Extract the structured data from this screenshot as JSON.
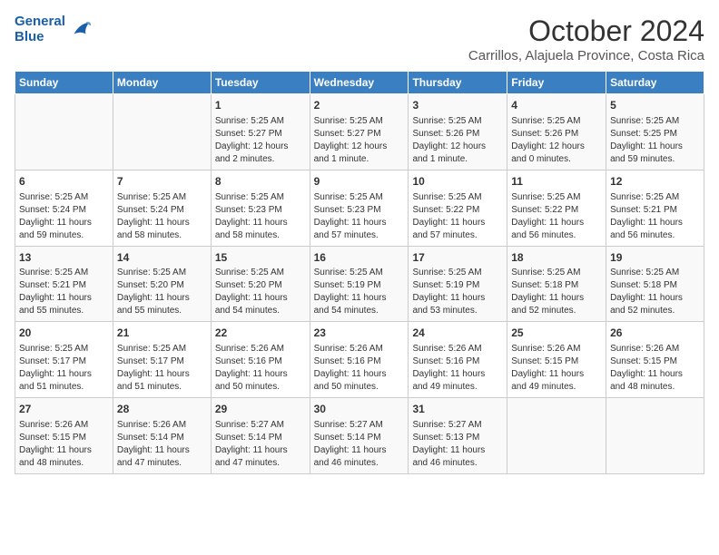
{
  "logo": {
    "line1": "General",
    "line2": "Blue"
  },
  "title": "October 2024",
  "subtitle": "Carrillos, Alajuela Province, Costa Rica",
  "days_of_week": [
    "Sunday",
    "Monday",
    "Tuesday",
    "Wednesday",
    "Thursday",
    "Friday",
    "Saturday"
  ],
  "weeks": [
    [
      {
        "day": "",
        "content": ""
      },
      {
        "day": "",
        "content": ""
      },
      {
        "day": "1",
        "content": "Sunrise: 5:25 AM\nSunset: 5:27 PM\nDaylight: 12 hours\nand 2 minutes."
      },
      {
        "day": "2",
        "content": "Sunrise: 5:25 AM\nSunset: 5:27 PM\nDaylight: 12 hours\nand 1 minute."
      },
      {
        "day": "3",
        "content": "Sunrise: 5:25 AM\nSunset: 5:26 PM\nDaylight: 12 hours\nand 1 minute."
      },
      {
        "day": "4",
        "content": "Sunrise: 5:25 AM\nSunset: 5:26 PM\nDaylight: 12 hours\nand 0 minutes."
      },
      {
        "day": "5",
        "content": "Sunrise: 5:25 AM\nSunset: 5:25 PM\nDaylight: 11 hours\nand 59 minutes."
      }
    ],
    [
      {
        "day": "6",
        "content": "Sunrise: 5:25 AM\nSunset: 5:24 PM\nDaylight: 11 hours\nand 59 minutes."
      },
      {
        "day": "7",
        "content": "Sunrise: 5:25 AM\nSunset: 5:24 PM\nDaylight: 11 hours\nand 58 minutes."
      },
      {
        "day": "8",
        "content": "Sunrise: 5:25 AM\nSunset: 5:23 PM\nDaylight: 11 hours\nand 58 minutes."
      },
      {
        "day": "9",
        "content": "Sunrise: 5:25 AM\nSunset: 5:23 PM\nDaylight: 11 hours\nand 57 minutes."
      },
      {
        "day": "10",
        "content": "Sunrise: 5:25 AM\nSunset: 5:22 PM\nDaylight: 11 hours\nand 57 minutes."
      },
      {
        "day": "11",
        "content": "Sunrise: 5:25 AM\nSunset: 5:22 PM\nDaylight: 11 hours\nand 56 minutes."
      },
      {
        "day": "12",
        "content": "Sunrise: 5:25 AM\nSunset: 5:21 PM\nDaylight: 11 hours\nand 56 minutes."
      }
    ],
    [
      {
        "day": "13",
        "content": "Sunrise: 5:25 AM\nSunset: 5:21 PM\nDaylight: 11 hours\nand 55 minutes."
      },
      {
        "day": "14",
        "content": "Sunrise: 5:25 AM\nSunset: 5:20 PM\nDaylight: 11 hours\nand 55 minutes."
      },
      {
        "day": "15",
        "content": "Sunrise: 5:25 AM\nSunset: 5:20 PM\nDaylight: 11 hours\nand 54 minutes."
      },
      {
        "day": "16",
        "content": "Sunrise: 5:25 AM\nSunset: 5:19 PM\nDaylight: 11 hours\nand 54 minutes."
      },
      {
        "day": "17",
        "content": "Sunrise: 5:25 AM\nSunset: 5:19 PM\nDaylight: 11 hours\nand 53 minutes."
      },
      {
        "day": "18",
        "content": "Sunrise: 5:25 AM\nSunset: 5:18 PM\nDaylight: 11 hours\nand 52 minutes."
      },
      {
        "day": "19",
        "content": "Sunrise: 5:25 AM\nSunset: 5:18 PM\nDaylight: 11 hours\nand 52 minutes."
      }
    ],
    [
      {
        "day": "20",
        "content": "Sunrise: 5:25 AM\nSunset: 5:17 PM\nDaylight: 11 hours\nand 51 minutes."
      },
      {
        "day": "21",
        "content": "Sunrise: 5:25 AM\nSunset: 5:17 PM\nDaylight: 11 hours\nand 51 minutes."
      },
      {
        "day": "22",
        "content": "Sunrise: 5:26 AM\nSunset: 5:16 PM\nDaylight: 11 hours\nand 50 minutes."
      },
      {
        "day": "23",
        "content": "Sunrise: 5:26 AM\nSunset: 5:16 PM\nDaylight: 11 hours\nand 50 minutes."
      },
      {
        "day": "24",
        "content": "Sunrise: 5:26 AM\nSunset: 5:16 PM\nDaylight: 11 hours\nand 49 minutes."
      },
      {
        "day": "25",
        "content": "Sunrise: 5:26 AM\nSunset: 5:15 PM\nDaylight: 11 hours\nand 49 minutes."
      },
      {
        "day": "26",
        "content": "Sunrise: 5:26 AM\nSunset: 5:15 PM\nDaylight: 11 hours\nand 48 minutes."
      }
    ],
    [
      {
        "day": "27",
        "content": "Sunrise: 5:26 AM\nSunset: 5:15 PM\nDaylight: 11 hours\nand 48 minutes."
      },
      {
        "day": "28",
        "content": "Sunrise: 5:26 AM\nSunset: 5:14 PM\nDaylight: 11 hours\nand 47 minutes."
      },
      {
        "day": "29",
        "content": "Sunrise: 5:27 AM\nSunset: 5:14 PM\nDaylight: 11 hours\nand 47 minutes."
      },
      {
        "day": "30",
        "content": "Sunrise: 5:27 AM\nSunset: 5:14 PM\nDaylight: 11 hours\nand 46 minutes."
      },
      {
        "day": "31",
        "content": "Sunrise: 5:27 AM\nSunset: 5:13 PM\nDaylight: 11 hours\nand 46 minutes."
      },
      {
        "day": "",
        "content": ""
      },
      {
        "day": "",
        "content": ""
      }
    ]
  ]
}
